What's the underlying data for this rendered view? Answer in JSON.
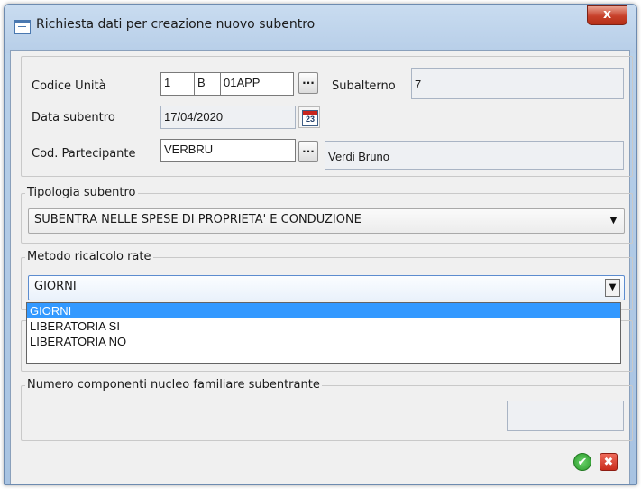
{
  "window": {
    "title": "Richiesta dati per creazione nuovo subentro",
    "close_label": "x"
  },
  "fields": {
    "codice_unita": {
      "label": "Codice Unità",
      "part1": "1",
      "part2": "B",
      "part3": "01APP"
    },
    "subalterno": {
      "label": "Subalterno",
      "value": "7"
    },
    "data_subentro": {
      "label": "Data subentro",
      "value": "17/04/2020",
      "calendar_day": "23"
    },
    "cod_partecipante": {
      "label": "Cod. Partecipante",
      "value": "VERBRU",
      "name": "Verdi Bruno"
    }
  },
  "dots_label": "...",
  "tipologia": {
    "legend": "Tipologia subentro",
    "selected": "SUBENTRA NELLE SPESE DI PROPRIETA' E CONDUZIONE"
  },
  "metodo": {
    "legend": "Metodo ricalcolo rate",
    "selected": "GIORNI",
    "options": [
      "GIORNI",
      "LIBERATORIA SI",
      "LIBERATORIA NO"
    ]
  },
  "numero_componenti": {
    "legend": "Numero componenti nucleo familiare subentrante",
    "value": ""
  },
  "buttons": {
    "ok_icon": "check-icon",
    "cancel_icon": "x-icon",
    "ok_glyph": "✔",
    "cancel_glyph": "✖"
  },
  "colors": {
    "selection": "#3399ff",
    "ok": "#2a9a2a",
    "cancel": "#c92c1c"
  }
}
